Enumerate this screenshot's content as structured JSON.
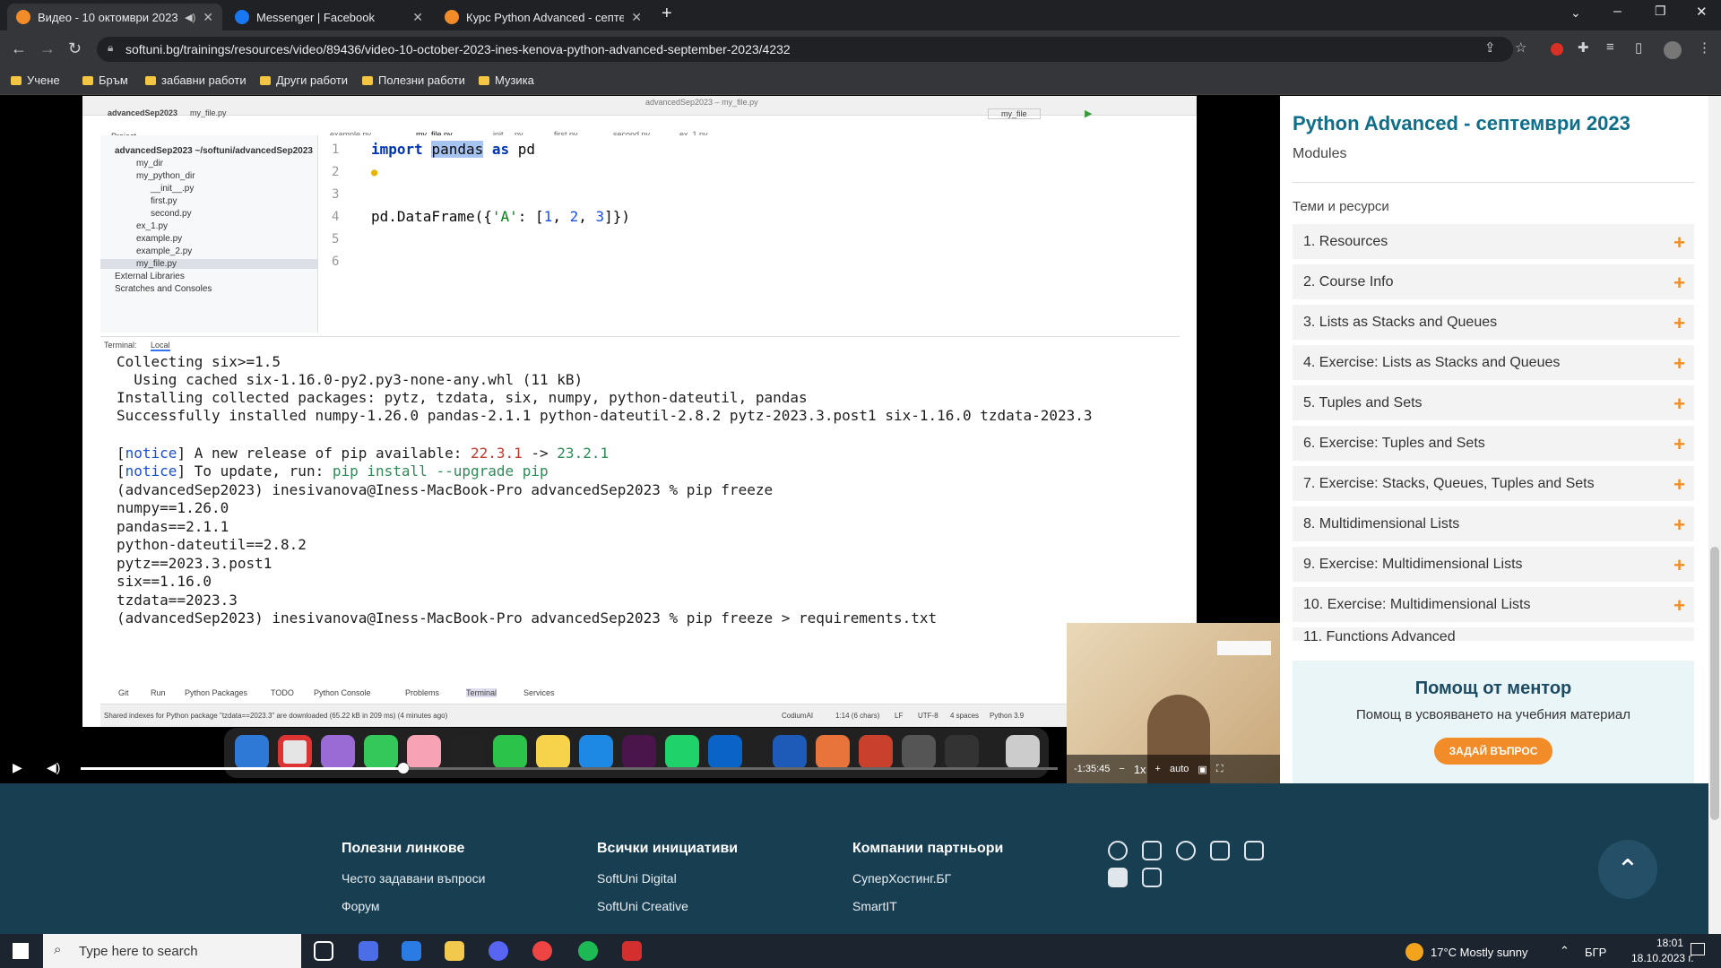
{
  "browser": {
    "tabs": [
      {
        "title": "Видео - 10 октомври 2023",
        "audio_icon": "speaker-icon"
      },
      {
        "title": "Messenger | Facebook"
      },
      {
        "title": "Курс Python Advanced - септем"
      }
    ],
    "url": "softuni.bg/trainings/resources/video/89436/video-10-october-2023-ines-kenova-python-advanced-september-2023/4232",
    "bookmarks": [
      "Учене",
      "Бръм",
      "забавни работи",
      "Други работи",
      "Полезни работи",
      "Музика"
    ]
  },
  "ide": {
    "window_title": "advancedSep2023 – my_file.py",
    "project_label": "advancedSep2023",
    "file_label": "my_file.py",
    "run_config": "my_file",
    "editor_tabs": [
      "example.py",
      "my_file.py",
      "__init__.py",
      "first.py",
      "second.py",
      "ex_1.py"
    ],
    "tree": [
      "Project",
      "advancedSep2023 ~/softuni/advancedSep2023",
      "my_dir",
      "my_python_dir",
      "__init__.py",
      "first.py",
      "second.py",
      "ex_1.py",
      "example.py",
      "example_2.py",
      "my_file.py",
      "External Libraries",
      "Scratches and Consoles"
    ],
    "line_numbers": [
      "1",
      "2",
      "3",
      "4",
      "5",
      "6"
    ],
    "code": {
      "import_kw": "import",
      "module": "pandas",
      "as_kw": "as",
      "alias": "pd",
      "line4_a": "pd.DataFrame({",
      "line4_key": "'A'",
      "line4_b": ": [",
      "line4_n1": "1",
      "line4_sep1": ", ",
      "line4_n2": "2",
      "line4_sep2": ", ",
      "line4_n3": "3",
      "line4_c": "]})"
    },
    "terminal_tab_label": "Terminal:",
    "terminal_local": "Local",
    "terminal_lines": {
      "l1": "Collecting six>=1.5",
      "l2": "  Using cached six-1.16.0-py2.py3-none-any.whl (11 kB)",
      "l3": "Installing collected packages: pytz, tzdata, six, numpy, python-dateutil, pandas",
      "l4": "Successfully installed numpy-1.26.0 pandas-2.1.1 python-dateutil-2.8.2 pytz-2023.3.post1 six-1.16.0 tzdata-2023.3",
      "n1_tag": "notice",
      "n1_text": " A new release of pip available: ",
      "n1_old": "22.3.1",
      "n1_arrow": " -> ",
      "n1_new": "23.2.1",
      "n2_tag": "notice",
      "n2_text": " To update, run: ",
      "n2_cmd": "pip install --upgrade pip",
      "l7": "(advancedSep2023) inesivanova@Iness-MacBook-Pro advancedSep2023 % pip freeze",
      "l8": "numpy==1.26.0",
      "l9": "pandas==2.1.1",
      "l10": "python-dateutil==2.8.2",
      "l11": "pytz==2023.3.post1",
      "l12": "six==1.16.0",
      "l13": "tzdata==2023.3",
      "l14": "(advancedSep2023) inesivanova@Iness-MacBook-Pro advancedSep2023 % pip freeze > requirements.txt"
    },
    "bottom_tabs": [
      "Git",
      "Run",
      "Python Packages",
      "TODO",
      "Python Console",
      "Problems",
      "Terminal",
      "Services"
    ],
    "status_left": "Shared indexes for Python package \"tzdata==2023.3\" are downloaded (65.22 kB in 209 ms) (4 minutes ago)",
    "status_right": [
      "CodiumAI",
      "1:14 (6 chars)",
      "LF",
      "UTF-8",
      "4 spaces",
      "Python 3.9"
    ]
  },
  "player": {
    "time_remaining": "-1:35:45",
    "speed": "1x",
    "quality": "auto",
    "progress_fraction": 0.33
  },
  "sidebar": {
    "course_title": "Python Advanced - септември 2023",
    "subtitle": "Modules",
    "section_label": "Теми и ресурси",
    "items": [
      "1. Resources",
      "2. Course Info",
      "3. Lists as Stacks and Queues",
      "4. Exercise: Lists as Stacks and Queues",
      "5. Tuples and Sets",
      "6. Exercise: Tuples and Sets",
      "7. Exercise: Stacks, Queues, Tuples and Sets",
      "8. Multidimensional Lists",
      "9. Exercise: Multidimensional Lists",
      "10. Exercise: Multidimensional Lists",
      "11. Functions Advanced"
    ],
    "mentor_title": "Помощ от ментор",
    "mentor_text": "Помощ в усвояването на учебния материал",
    "mentor_button": "ЗАДАЙ ВЪПРОС"
  },
  "footer": {
    "col1_title": "Полезни линкове",
    "col1_links": [
      "Често задавани въпроси",
      "Форум"
    ],
    "col2_title": "Всички инициативи",
    "col2_links": [
      "SoftUni Digital",
      "SoftUni Creative"
    ],
    "col3_title": "Компании партньори",
    "col3_links": [
      "СуперХостинг.БГ",
      "SmartIT"
    ],
    "social_icons": [
      "facebook-icon",
      "instagram-icon",
      "github-icon",
      "tiktok-icon",
      "linkedin-icon",
      "youtube-icon",
      "telegram-icon"
    ]
  },
  "taskbar": {
    "search_placeholder": "Type here to search",
    "weather": "17°C  Mostly sunny",
    "lang": "БГР",
    "time": "18:01",
    "date": "18.10.2023 г."
  },
  "colors": {
    "accent": "#f28c28",
    "brand_title": "#0f6e8a",
    "footer_bg": "#183e52"
  }
}
